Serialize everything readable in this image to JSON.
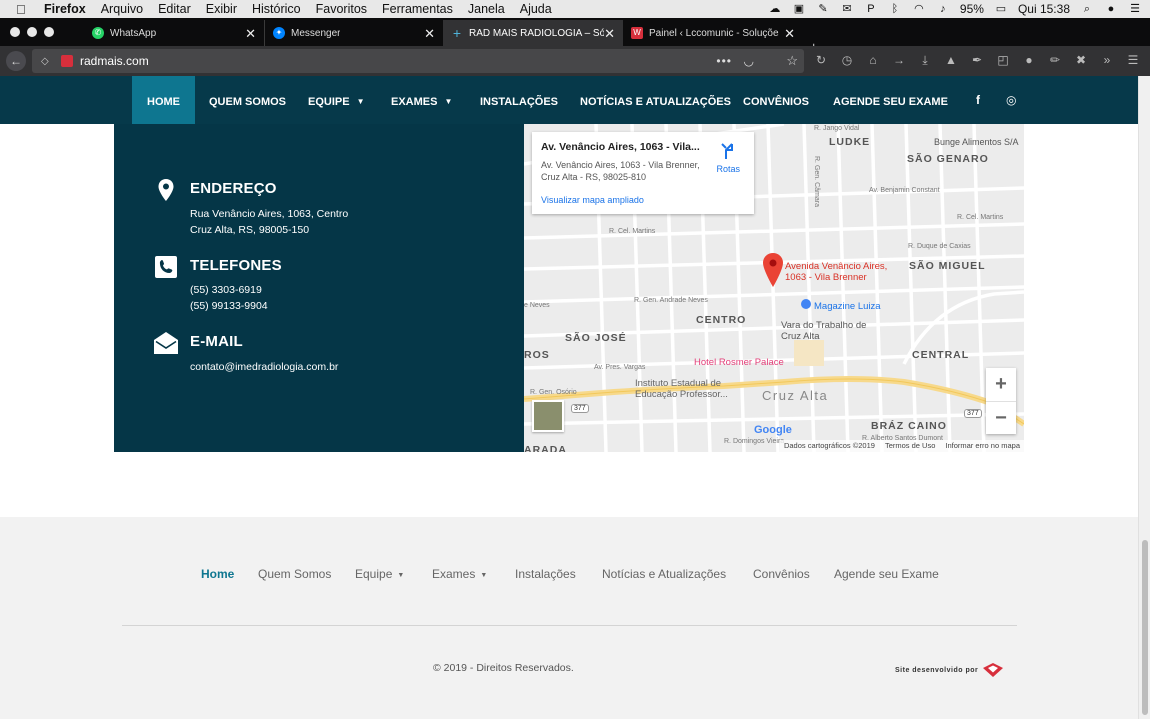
{
  "os_menubar": {
    "app_name": "Firefox",
    "items": [
      "Arquivo",
      "Editar",
      "Exibir",
      "Histórico",
      "Favoritos",
      "Ferramentas",
      "Janela",
      "Ajuda"
    ],
    "battery": "95%",
    "clock": "Qui 15:38"
  },
  "browser": {
    "tabs": [
      {
        "title": "WhatsApp",
        "icon": "whatsapp-icon",
        "color": "#25d366"
      },
      {
        "title": "Messenger",
        "icon": "messenger-icon",
        "color": "#0084ff"
      },
      {
        "title": "RAD MAIS RADIOLOGIA – Só m",
        "icon": "plus-cross-icon",
        "color": "#4fb3d9"
      },
      {
        "title": "Painel ‹ Lccomunic - Soluções",
        "icon": "wordpress-icon",
        "color": "#d72f3c"
      }
    ],
    "url": "radmais.com"
  },
  "site_nav": {
    "items": [
      "HOME",
      "QUEM SOMOS",
      "EQUIPE",
      "EXAMES",
      "INSTALAÇÕES",
      "NOTÍCIAS E ATUALIZAÇÕES",
      "CONVÊNIOS",
      "AGENDE SEU EXAME"
    ],
    "social": {
      "facebook": "f",
      "instagram": "◎"
    }
  },
  "contact": {
    "address_title": "ENDEREÇO",
    "address_line1": "Rua Venâncio Aires, 1063, Centro",
    "address_line2": "Cruz Alta, RS, 98005-150",
    "phones_title": "TELEFONES",
    "phone1": "(55) 3303-6919",
    "phone2": "(55) 99133-9904",
    "email_title": "E-MAIL",
    "email": "contato@imedradiologia.com.br"
  },
  "map": {
    "card_title": "Av. Venâncio Aires, 1063 - Vila...",
    "card_address": "Av. Venâncio Aires, 1063 - Vila Brenner, Cruz Alta - RS, 98025-810",
    "card_link": "Visualizar mapa ampliado",
    "directions": "Rotas",
    "pin_label": "Avenida Venâncio Aires, 1063 - Vila Brenner",
    "districts": [
      "LUDKE",
      "SÃO GENARO",
      "SÃO MIGUEL",
      "CENTRO",
      "SÃO JOSÉ",
      "CENTRAL",
      "BRÁZ CAINO",
      "Cruz Alta",
      "ROS",
      "ARADA"
    ],
    "streets": [
      "R. Jango Vidal",
      "R. Gen. Câmara",
      "Av. Benjamin Constant",
      "R. Cel. Martins",
      "R. Duque de Caxias",
      "R. Cel. Martins",
      "R. Gen. Andrade Neves",
      "Av. Pres. Vargas",
      "R. Gen. Osório",
      "R. Domingos Vieira",
      "R. Alberto Santos Dumont",
      "Bunge Alimentos S/A",
      "e Neves"
    ],
    "pois": [
      "Magazine Luiza",
      "Vara do Trabalho de Cruz Alta",
      "Hotel Rosmer Palace",
      "Instituto Estadual de Educação Professor..."
    ],
    "route_badges": [
      "377",
      "377"
    ],
    "google": "Google",
    "attribution": [
      "Dados cartográficos ©2019",
      "Termos de Uso",
      "Informar erro no mapa"
    ]
  },
  "footer": {
    "nav": [
      "Home",
      "Quem Somos",
      "Equipe",
      "Exames",
      "Instalações",
      "Notícias e Atualizações",
      "Convênios",
      "Agende seu Exame"
    ],
    "copyright": "© 2019 - Direitos Reservados.",
    "developer": "Site desenvolvido por"
  },
  "colors": {
    "nav_bg": "#06394a",
    "nav_active": "#0e7690",
    "contact_bg": "#053647",
    "footer_bg": "#f2f2f2"
  }
}
